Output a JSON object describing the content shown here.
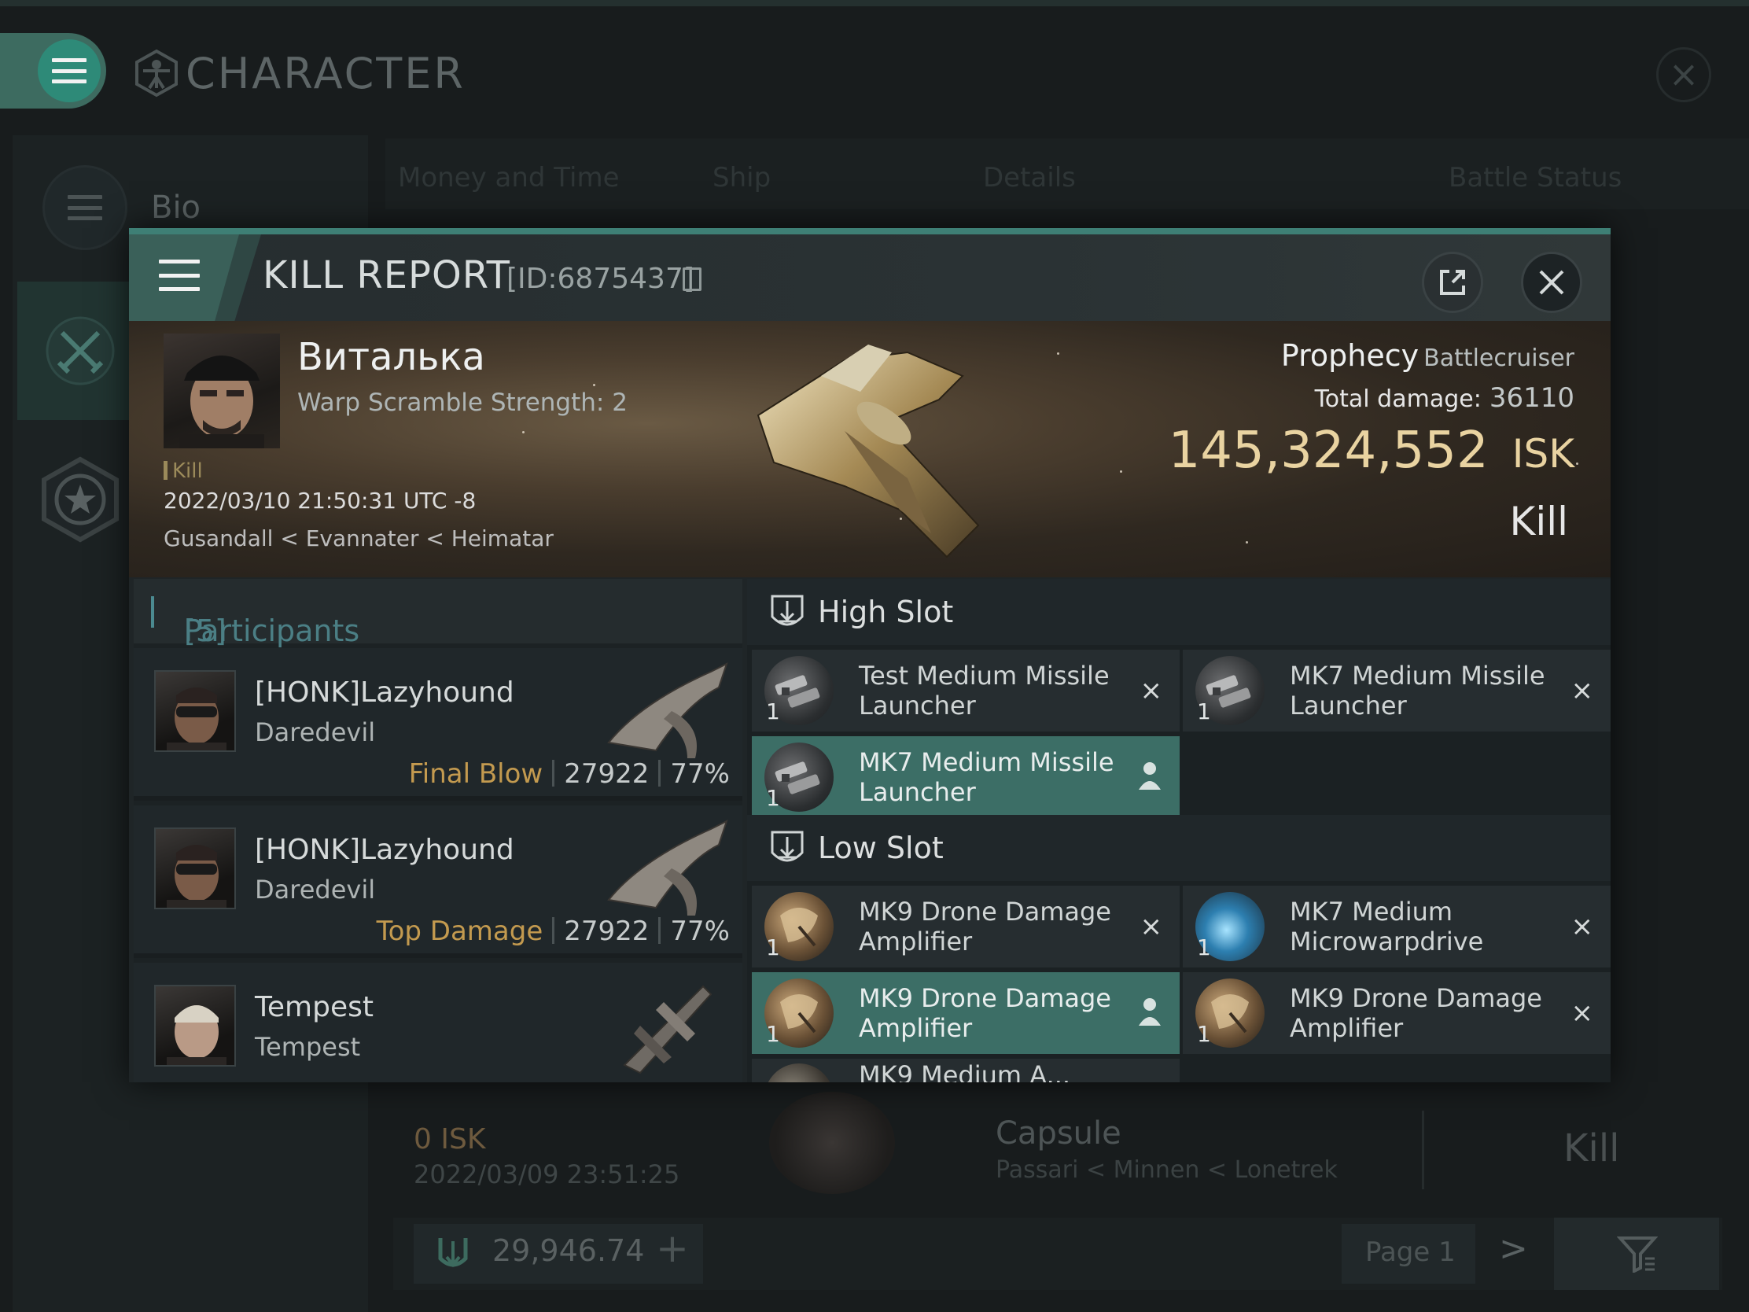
{
  "background": {
    "window_title": "CHARACTER",
    "sidebar": {
      "bio_label": "Bio"
    },
    "tabs": [
      "Money and Time",
      "Ship",
      "Details",
      "Battle Status"
    ],
    "capsule_row": {
      "isk": "0  ISK",
      "date": "2022/03/09  23:51:25",
      "ship": "Capsule",
      "location": "Passari < Minnen < Lonetrek",
      "result": "Kill"
    },
    "bottom_bar": {
      "isk_value": "29,946.74",
      "page_label": "Page 1",
      "add_label": "+",
      "next_label": ">"
    }
  },
  "kill_report": {
    "title": "KILL REPORT",
    "id_label": "[ID:6875437]",
    "victim": {
      "name": "Виталька",
      "subtitle": "Warp Scramble Strength: 2",
      "tag": "Kill",
      "datetime": "2022/03/10 21:50:31 UTC -8",
      "location": "Gusandall < Evannater < Heimatar"
    },
    "ship": {
      "name": "Prophecy",
      "class": "Battlecruiser",
      "total_damage_label": "Total damage:",
      "total_damage_value": "36110",
      "isk_value": "145,324,552",
      "isk_unit": "ISK",
      "result": "Kill"
    },
    "participants": {
      "header": "Participants",
      "count": "[5]",
      "rows": [
        {
          "name": "[HONK]Lazyhound",
          "ship": "Daredevil",
          "tag": "Final Blow",
          "damage": "27922",
          "percent": "77%"
        },
        {
          "name": "[HONK]Lazyhound",
          "ship": "Daredevil",
          "tag": "Top Damage",
          "damage": "27922",
          "percent": "77%"
        },
        {
          "name": "Tempest",
          "ship": "Tempest",
          "tag": "",
          "damage": "",
          "percent": ""
        }
      ]
    },
    "high_slot": {
      "label": "High Slot",
      "items": [
        {
          "name": "Test Medium Missile Launcher",
          "qty": "1",
          "status": "×"
        },
        {
          "name": "MK7 Medium Missile Launcher",
          "qty": "1",
          "status": "×"
        },
        {
          "name": "MK7 Medium Missile Launcher",
          "qty": "1",
          "status": "person"
        }
      ]
    },
    "low_slot": {
      "label": "Low Slot",
      "items": [
        {
          "name": "MK9 Drone Damage Amplifier",
          "qty": "1",
          "status": "×"
        },
        {
          "name": "MK7 Medium Microwarpdrive",
          "qty": "1",
          "status": "×"
        },
        {
          "name": "MK9 Drone Damage Amplifier",
          "qty": "1",
          "status": "person"
        },
        {
          "name": "MK9 Drone Damage Amplifier",
          "qty": "1",
          "status": "×"
        }
      ]
    },
    "next_item_partial": "MK9 Medium A..."
  }
}
